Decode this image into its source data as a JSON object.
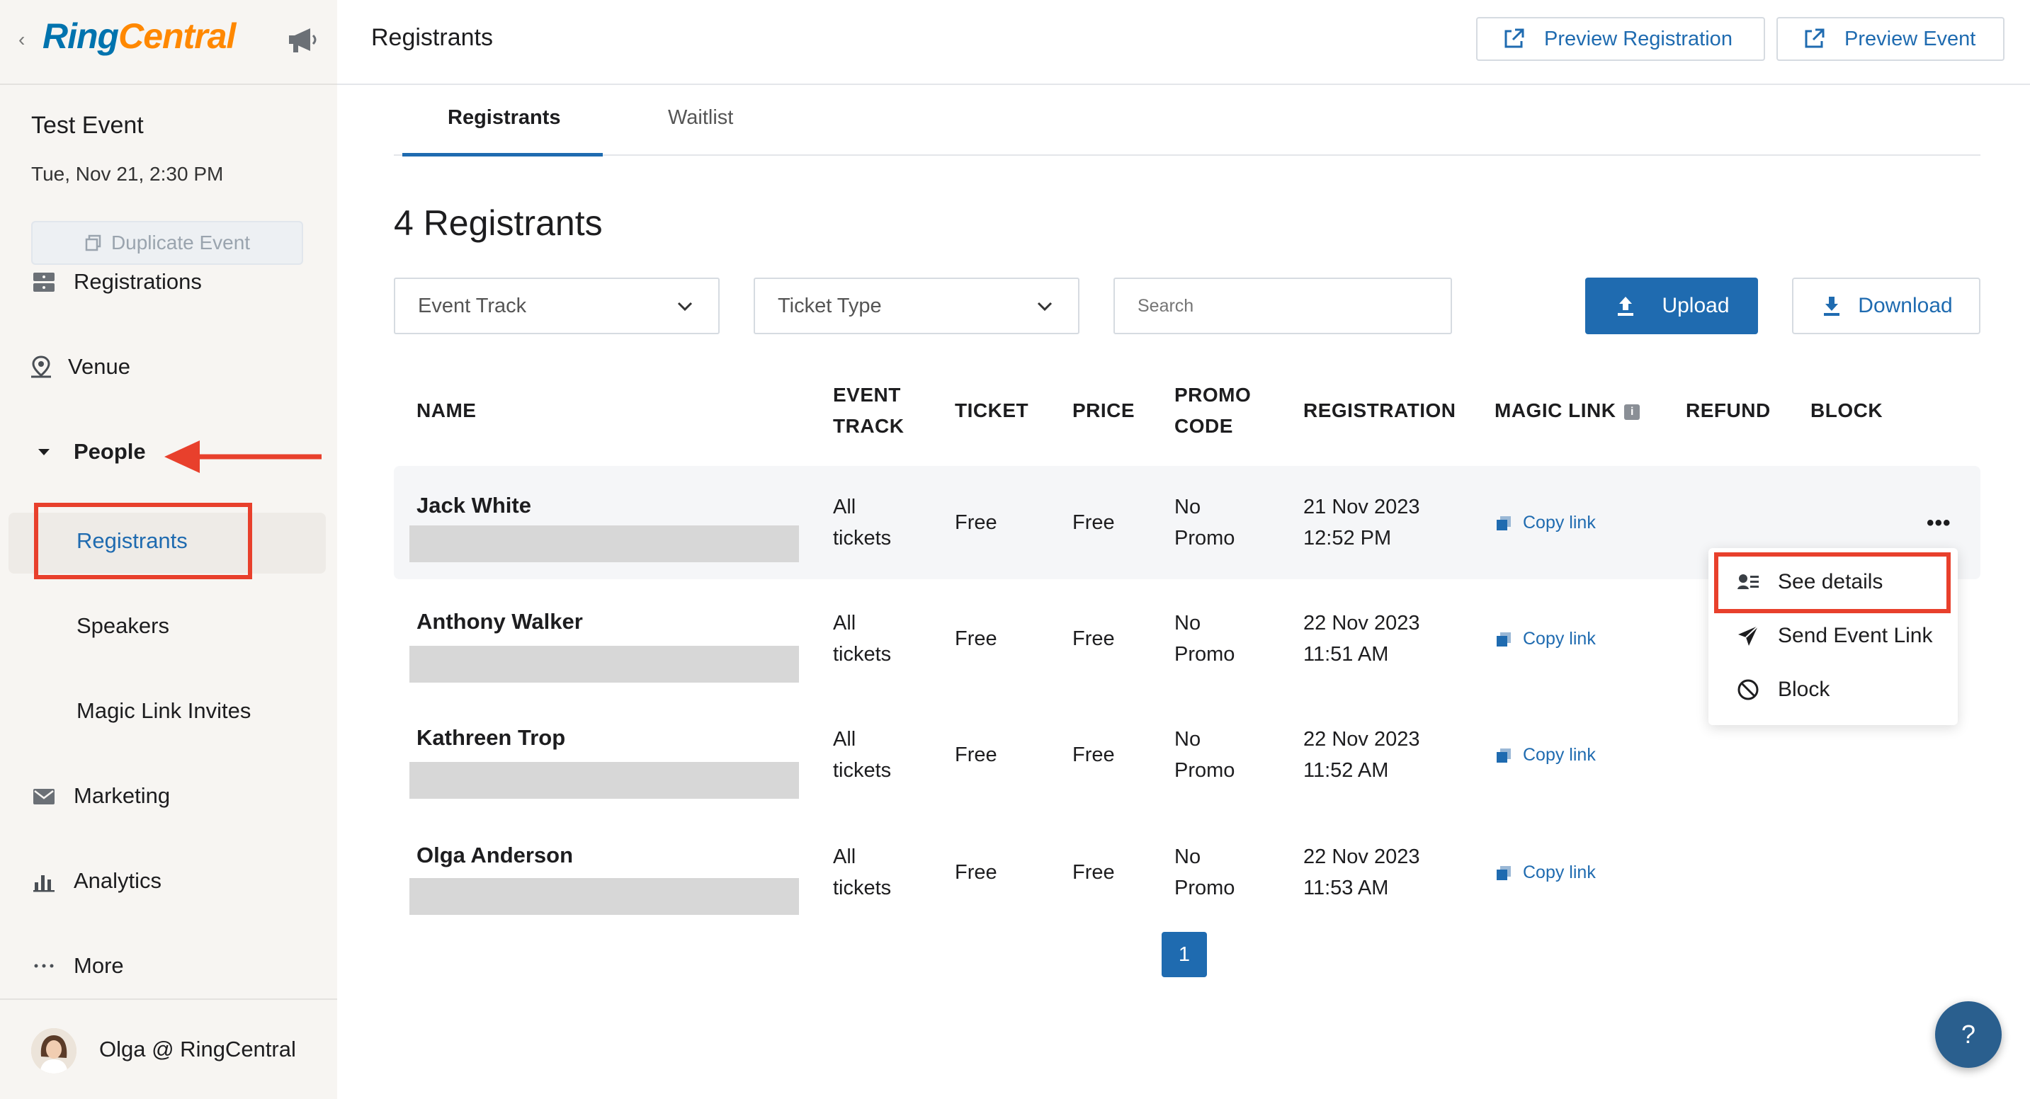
{
  "sidebar": {
    "back_glyph": "‹",
    "logo": {
      "ring": "Ring",
      "central": "Central"
    },
    "event_title": "Test Event",
    "event_date": "Tue, Nov 21, 2:30 PM",
    "duplicate_label": "Duplicate Event",
    "nav": {
      "registrations": "Registrations",
      "venue": "Venue",
      "people": "People",
      "registrants": "Registrants",
      "speakers": "Speakers",
      "magic_link_invites": "Magic Link Invites",
      "marketing": "Marketing",
      "analytics": "Analytics",
      "more": "More"
    },
    "user_name": "Olga @ RingCentral"
  },
  "topbar": {
    "title": "Registrants",
    "preview_registration": "Preview Registration",
    "preview_event": "Preview Event"
  },
  "tabs": [
    {
      "label": "Registrants",
      "active": true
    },
    {
      "label": "Waitlist",
      "active": false
    }
  ],
  "main": {
    "count_title": "4 Registrants",
    "filters": {
      "event_track": "Event Track",
      "ticket_type": "Ticket Type",
      "search_placeholder": "Search"
    },
    "upload_label": "Upload",
    "download_label": "Download"
  },
  "table": {
    "headers": {
      "name": "NAME",
      "event_track_1": "EVENT",
      "event_track_2": "TRACK",
      "ticket": "TICKET",
      "price": "PRICE",
      "promo_1": "PROMO",
      "promo_2": "CODE",
      "registration": "REGISTRATION",
      "magic_link": "MAGIC LINK",
      "info_glyph": "i",
      "refund": "REFUND",
      "block": "BLOCK"
    },
    "rows": [
      {
        "name": "Jack White",
        "track_1": "All",
        "track_2": "tickets",
        "ticket": "Free",
        "price": "Free",
        "promo_1": "No",
        "promo_2": "Promo",
        "reg_date": "21 Nov 2023",
        "reg_time": "12:52 PM",
        "magic_link": "Copy link"
      },
      {
        "name": "Anthony Walker",
        "track_1": "All",
        "track_2": "tickets",
        "ticket": "Free",
        "price": "Free",
        "promo_1": "No",
        "promo_2": "Promo",
        "reg_date": "22 Nov 2023",
        "reg_time": "11:51 AM",
        "magic_link": "Copy link"
      },
      {
        "name": "Kathreen Trop",
        "track_1": "All",
        "track_2": "tickets",
        "ticket": "Free",
        "price": "Free",
        "promo_1": "No",
        "promo_2": "Promo",
        "reg_date": "22 Nov 2023",
        "reg_time": "11:52 AM",
        "magic_link": "Copy link"
      },
      {
        "name": "Olga Anderson",
        "track_1": "All",
        "track_2": "tickets",
        "ticket": "Free",
        "price": "Free",
        "promo_1": "No",
        "promo_2": "Promo",
        "reg_date": "22 Nov 2023",
        "reg_time": "11:53 AM",
        "magic_link": "Copy link"
      }
    ],
    "row_menu_glyph": "•••"
  },
  "row_menu": {
    "see_details": "See details",
    "send_event_link": "Send Event Link",
    "block": "Block"
  },
  "pagination": {
    "current": "1"
  },
  "help": {
    "label": "?"
  },
  "icons": {
    "megaphone": "megaphone-icon",
    "duplicate": "duplicate-icon",
    "registrations": "registrations-icon",
    "venue": "venue-pin-icon",
    "people": "caret-down-icon",
    "marketing": "envelope-icon",
    "analytics": "bar-chart-icon",
    "more": "ellipsis-icon",
    "external": "external-link-icon",
    "chevron": "chevron-down-icon",
    "upload": "upload-icon",
    "download": "download-icon",
    "copy": "copy-icon",
    "details": "details-icon",
    "send": "send-icon",
    "block": "block-icon"
  },
  "colors": {
    "brand_blue": "#1f6bb0",
    "logo_blue": "#0073ae",
    "logo_orange": "#ff8800",
    "annotation_red": "#e8402c",
    "sidebar_bg": "#f7f5f2"
  }
}
